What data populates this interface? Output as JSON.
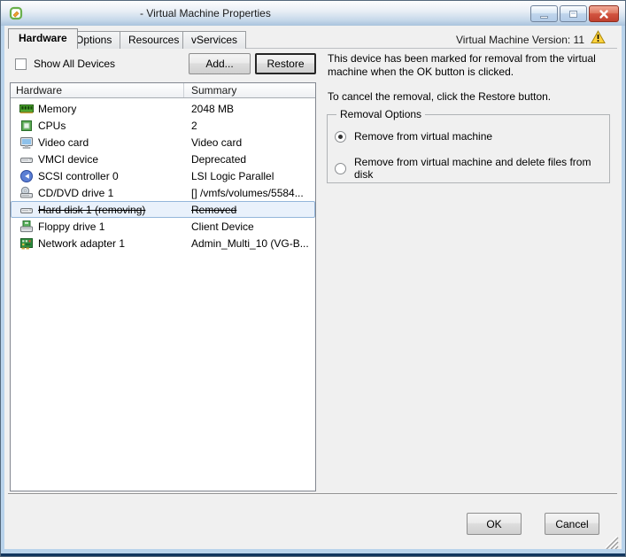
{
  "window": {
    "title": "- Virtual Machine Properties",
    "version_label": "Virtual Machine Version: 11",
    "icons": [
      "vmware-vm-icon",
      "minimize-icon",
      "maximize-icon",
      "close-icon",
      "warning-icon"
    ]
  },
  "tabs": [
    {
      "label": "Hardware",
      "active": true
    },
    {
      "label": "Options",
      "active": false
    },
    {
      "label": "Resources",
      "active": false
    },
    {
      "label": "vServices",
      "active": false
    }
  ],
  "toolbar": {
    "show_all_devices_label": "Show All Devices",
    "show_all_devices_checked": false,
    "add_button": "Add...",
    "restore_button": "Restore"
  },
  "device_table": {
    "columns": [
      "Hardware",
      "Summary"
    ],
    "rows": [
      {
        "icon": "memory-icon",
        "label": "Memory",
        "summary": "2048 MB",
        "selected": false,
        "strikethrough": false
      },
      {
        "icon": "cpu-icon",
        "label": "CPUs",
        "summary": "2",
        "selected": false,
        "strikethrough": false
      },
      {
        "icon": "video-card-icon",
        "label": "Video card",
        "summary": "Video card",
        "selected": false,
        "strikethrough": false
      },
      {
        "icon": "vmci-device-icon",
        "label": "VMCI device",
        "summary": "Deprecated",
        "selected": false,
        "strikethrough": false
      },
      {
        "icon": "scsi-controller-icon",
        "label": "SCSI controller 0",
        "summary": "LSI Logic Parallel",
        "selected": false,
        "strikethrough": false
      },
      {
        "icon": "cd-dvd-icon",
        "label": "CD/DVD drive 1",
        "summary": "[] /vmfs/volumes/5584...",
        "selected": false,
        "strikethrough": false
      },
      {
        "icon": "hard-disk-icon",
        "label": "Hard disk 1 (removing)",
        "summary": "Removed",
        "selected": true,
        "strikethrough": true
      },
      {
        "icon": "floppy-icon",
        "label": "Floppy drive 1",
        "summary": "Client Device",
        "selected": false,
        "strikethrough": false
      },
      {
        "icon": "network-adapter-icon",
        "label": "Network adapter 1",
        "summary": "Admin_Multi_10 (VG-B...",
        "selected": false,
        "strikethrough": false
      }
    ]
  },
  "info_panel": {
    "line1": "This device has been marked for removal from the virtual machine when the OK button is clicked.",
    "line2": "To cancel the removal, click the Restore button.",
    "removal_options": {
      "title": "Removal Options",
      "options": [
        {
          "label": "Remove from virtual machine",
          "selected": true
        },
        {
          "label": "Remove from virtual machine and delete files from disk",
          "selected": false
        }
      ]
    }
  },
  "footer": {
    "ok_button": "OK",
    "cancel_button": "Cancel"
  },
  "colors": {
    "dialog_background": "#f0f0f0",
    "titlebar_gradient_bottom": "#a9c2dc",
    "window_edge_blue": "#b9d3eb",
    "window_edge_dark": "#12365e",
    "close_button_red": "#d25441",
    "selection_background": "#e9f1fb",
    "selection_border": "#94b6da",
    "warning_yellow": "#ffd23e"
  }
}
